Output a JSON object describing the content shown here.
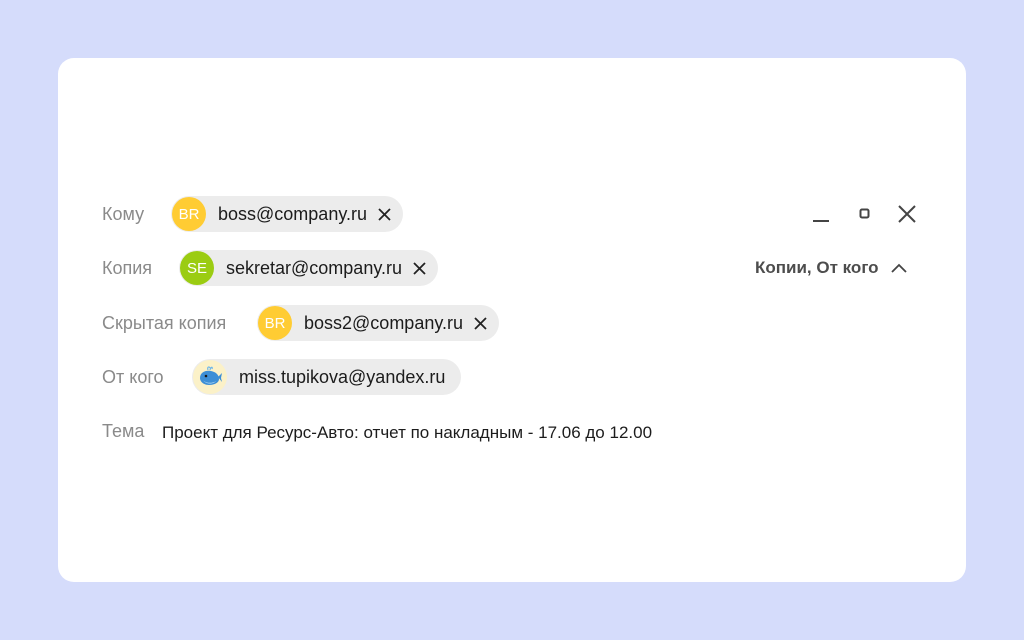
{
  "fields": {
    "to": {
      "label": "Кому",
      "initials": "BR",
      "avatar_color": "#ffcc33",
      "email": "boss@company.ru"
    },
    "cc": {
      "label": "Копия",
      "initials": "SE",
      "avatar_color": "#9bcc12",
      "email": "sekretar@company.ru"
    },
    "bcc": {
      "label": "Скрытая копия",
      "initials": "BR",
      "avatar_color": "#ffcc33",
      "email": "boss2@company.ru"
    },
    "from": {
      "label": "От кого",
      "avatar_icon": "whale-avatar-icon",
      "email": "miss.tupikova@yandex.ru"
    },
    "subject": {
      "label": "Тема",
      "value": "Проект для Ресурс-Авто: отчет по накладным - 17.06 до 12.00"
    }
  },
  "toggle": {
    "label": "Копии, От кого",
    "icon": "chevron-up-icon"
  },
  "window_controls": [
    "minimize-icon",
    "restore-icon",
    "close-icon"
  ],
  "colors": {
    "background": "#d5dcfb",
    "chip": "#ececec",
    "label": "#8a8a8a"
  }
}
